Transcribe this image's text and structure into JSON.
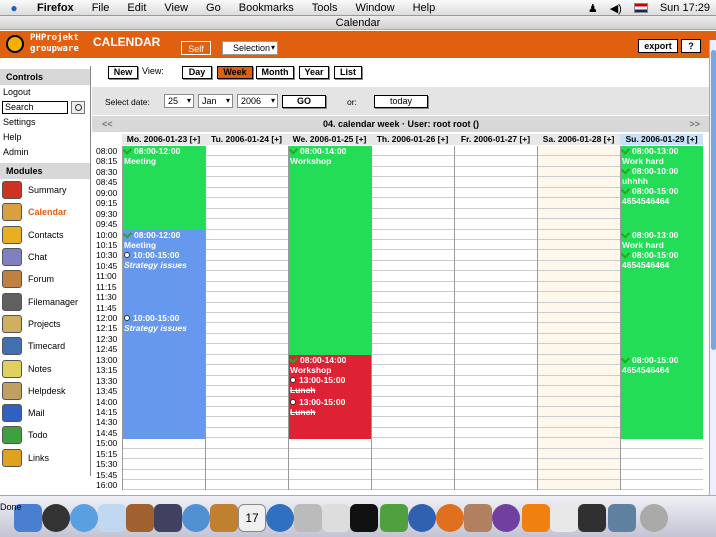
{
  "menubar": {
    "items": [
      "Firefox",
      "File",
      "Edit",
      "View",
      "Go",
      "Bookmarks",
      "Tools",
      "Window",
      "Help"
    ],
    "clock": "Sun 17:29"
  },
  "window": {
    "title": "Calendar"
  },
  "header": {
    "logo_line1": "PHProjekt",
    "logo_line2": "groupware",
    "title": "CALENDAR",
    "tab_self": "Self",
    "tab_selection": "Selection",
    "export_label": "export",
    "help_label": "?"
  },
  "sidebar": {
    "controls_title": "Controls",
    "links": [
      "Logout",
      "Settings",
      "Help",
      "Admin"
    ],
    "search_value": "Search",
    "modules_title": "Modules",
    "modules": [
      {
        "label": "Summary",
        "icon": "summary-icon",
        "color": "#cc3322"
      },
      {
        "label": "Calendar",
        "icon": "calendar-icon",
        "color": "#d8a040"
      },
      {
        "label": "Contacts",
        "icon": "contacts-icon",
        "color": "#e8b020"
      },
      {
        "label": "Chat",
        "icon": "chat-icon",
        "color": "#8080c0"
      },
      {
        "label": "Forum",
        "icon": "forum-icon",
        "color": "#c08040"
      },
      {
        "label": "Filemanager",
        "icon": "filemanager-icon",
        "color": "#606060"
      },
      {
        "label": "Projects",
        "icon": "projects-icon",
        "color": "#d0b060"
      },
      {
        "label": "Timecard",
        "icon": "timecard-icon",
        "color": "#4070b0"
      },
      {
        "label": "Notes",
        "icon": "notes-icon",
        "color": "#e0d060"
      },
      {
        "label": "Helpdesk",
        "icon": "helpdesk-icon",
        "color": "#c0a060"
      },
      {
        "label": "Mail",
        "icon": "mail-icon",
        "color": "#3060c0"
      },
      {
        "label": "Todo",
        "icon": "todo-icon",
        "color": "#40a040"
      },
      {
        "label": "Links",
        "icon": "links-icon",
        "color": "#e0a020"
      }
    ]
  },
  "toolbar": {
    "new_label": "New",
    "view_label": "View:",
    "views": [
      "Day",
      "Week",
      "Month",
      "Year",
      "List"
    ],
    "active_view": "Week"
  },
  "datebar": {
    "select_label": "Select date:",
    "day": "25",
    "month": "Jan",
    "year": "2006",
    "go_label": "GO",
    "or_label": "or:",
    "today_label": "today"
  },
  "calendar": {
    "week_title": "04. calendar week  ·  User: root root ()",
    "prev": "<<",
    "next": ">>",
    "days": [
      "Mo. 2006-01-23 [+]",
      "Tu. 2006-01-24 [+]",
      "We. 2006-01-25 [+]",
      "Th. 2006-01-26 [+]",
      "Fr. 2006-01-27 [+]",
      "Sa. 2006-01-28 [+]",
      "Su. 2006-01-29 [+]"
    ],
    "times": [
      "08:00",
      "08:15",
      "08:30",
      "08:45",
      "09:00",
      "09:15",
      "09:30",
      "09:45",
      "10:00",
      "10:15",
      "10:30",
      "10:45",
      "11:00",
      "11:15",
      "11:30",
      "11:45",
      "12:00",
      "12:15",
      "12:30",
      "12:45",
      "13:00",
      "13:15",
      "13:30",
      "13:45",
      "14:00",
      "14:15",
      "14:30",
      "14:45",
      "15:00",
      "15:15",
      "15:30",
      "15:45",
      "16:00"
    ],
    "colors": {
      "green": "#22dd55",
      "blue": "#6699ee",
      "red": "#dd2233"
    },
    "events": [
      {
        "day": 0,
        "start": 0,
        "end": 8,
        "color": "green",
        "lines": [
          {
            "t": "08:00-12:00",
            "k": "ok"
          },
          {
            "t": "Meeting"
          }
        ]
      },
      {
        "day": 0,
        "start": 8,
        "end": 28,
        "color": "blue",
        "lines": [
          {
            "t": "08:00-12:00",
            "k": "ok"
          },
          {
            "t": "Meeting"
          },
          {
            "t": "10:00-15:00",
            "k": "dot"
          },
          {
            "t": "Strategy issues",
            "s": "it"
          }
        ]
      },
      {
        "day": 0,
        "start": 16,
        "end": 28,
        "color": "blue",
        "lines": [
          {
            "t": "10:00-15:00",
            "k": "dot"
          },
          {
            "t": "Strategy issues",
            "s": "it"
          }
        ]
      },
      {
        "day": 2,
        "start": 0,
        "end": 20,
        "color": "green",
        "lines": [
          {
            "t": "08:00-14:00",
            "k": "ok"
          },
          {
            "t": "Workshop"
          }
        ]
      },
      {
        "day": 2,
        "start": 20,
        "end": 24,
        "color": "red",
        "lines": [
          {
            "t": "08:00-14:00",
            "k": "ok"
          },
          {
            "t": "Workshop"
          },
          {
            "t": "13:00-15:00",
            "k": "dot"
          },
          {
            "t": "Lunch",
            "s": "st"
          }
        ]
      },
      {
        "day": 2,
        "start": 24,
        "end": 28,
        "color": "red",
        "lines": [
          {
            "t": "13:00-15:00",
            "k": "dot"
          },
          {
            "t": "Lunch",
            "s": "st"
          }
        ]
      },
      {
        "day": 6,
        "start": 0,
        "end": 8,
        "color": "green",
        "lines": [
          {
            "t": "08:00-13:00",
            "k": "ok"
          },
          {
            "t": "Work hard"
          },
          {
            "t": "08:00-10:00",
            "k": "ok"
          },
          {
            "t": "uhhhh"
          },
          {
            "t": "08:00-15:00",
            "k": "ok"
          },
          {
            "t": "4654546464"
          }
        ]
      },
      {
        "day": 6,
        "start": 8,
        "end": 20,
        "color": "green",
        "lines": [
          {
            "t": "08:00-13:00",
            "k": "ok"
          },
          {
            "t": "Work hard"
          },
          {
            "t": "08:00-15:00",
            "k": "ok"
          },
          {
            "t": "4654546464"
          }
        ]
      },
      {
        "day": 6,
        "start": 20,
        "end": 28,
        "color": "green",
        "lines": [
          {
            "t": "08:00-15:00",
            "k": "ok"
          },
          {
            "t": "4654546464"
          }
        ]
      }
    ]
  },
  "statusbar": {
    "text": "Done"
  }
}
